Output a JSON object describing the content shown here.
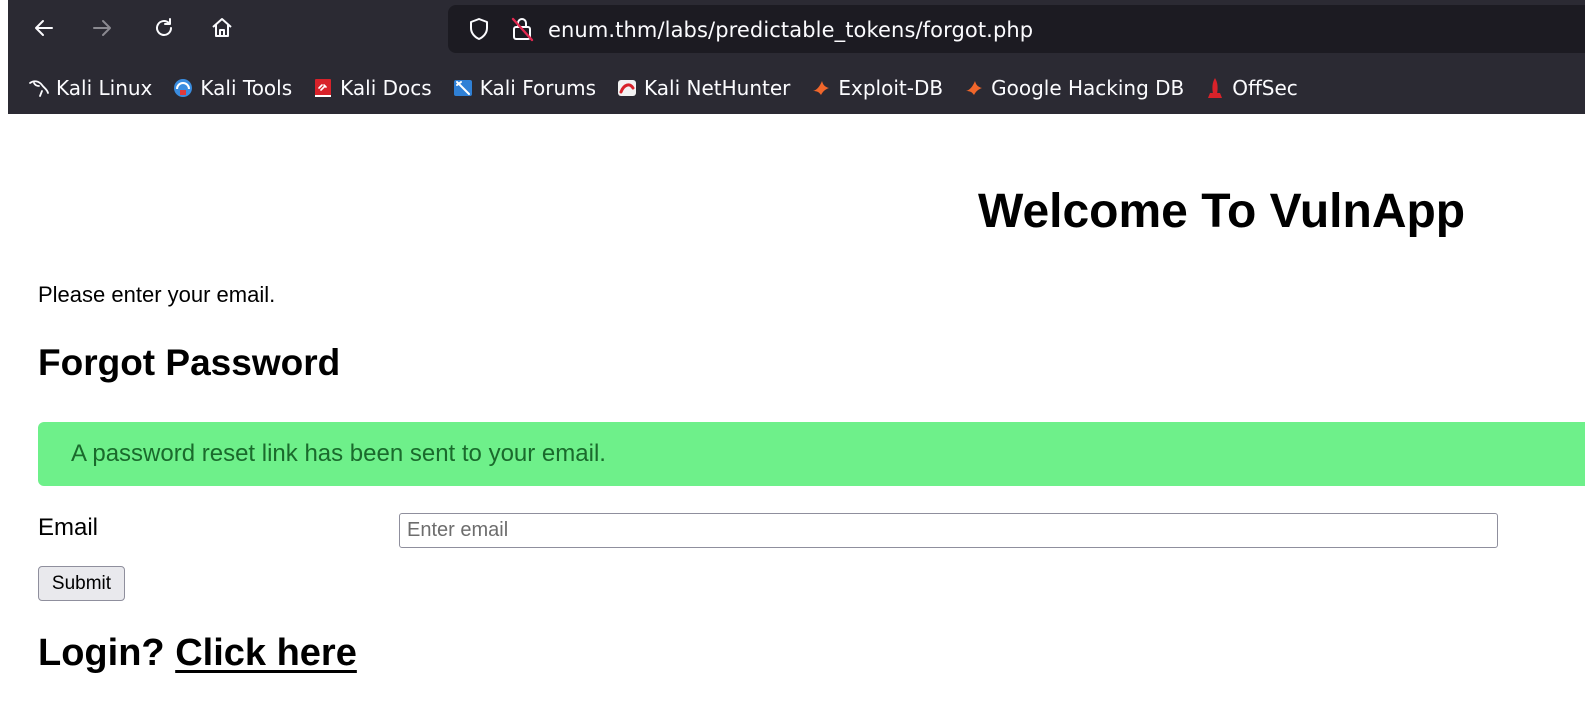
{
  "browser": {
    "url": "enum.thm/labs/predictable_tokens/forgot.php",
    "bookmarks": [
      {
        "label": "Kali Linux",
        "icon": "kali-dragon-icon"
      },
      {
        "label": "Kali Tools",
        "icon": "kali-tools-icon"
      },
      {
        "label": "Kali Docs",
        "icon": "kali-docs-icon"
      },
      {
        "label": "Kali Forums",
        "icon": "kali-forums-icon"
      },
      {
        "label": "Kali NetHunter",
        "icon": "kali-nethunter-icon"
      },
      {
        "label": "Exploit-DB",
        "icon": "exploit-db-icon"
      },
      {
        "label": "Google Hacking DB",
        "icon": "google-hacking-db-icon"
      },
      {
        "label": "OffSec",
        "icon": "offsec-icon"
      }
    ],
    "colors": {
      "toolbar": "#2b2a33",
      "urlbar": "#1c1b22",
      "text": "#fbfbfe"
    }
  },
  "page": {
    "heading": "Welcome To VulnApp",
    "instruction": "Please enter your email.",
    "form_title": "Forgot Password",
    "alert": "A password reset link has been sent to your email.",
    "email_label": "Email",
    "email_placeholder": "Enter email",
    "submit_label": "Submit",
    "login_prompt": "Login?",
    "login_link": "Click here",
    "colors": {
      "alert_bg": "#6ef08a",
      "alert_text": "#1a6a2c"
    }
  }
}
